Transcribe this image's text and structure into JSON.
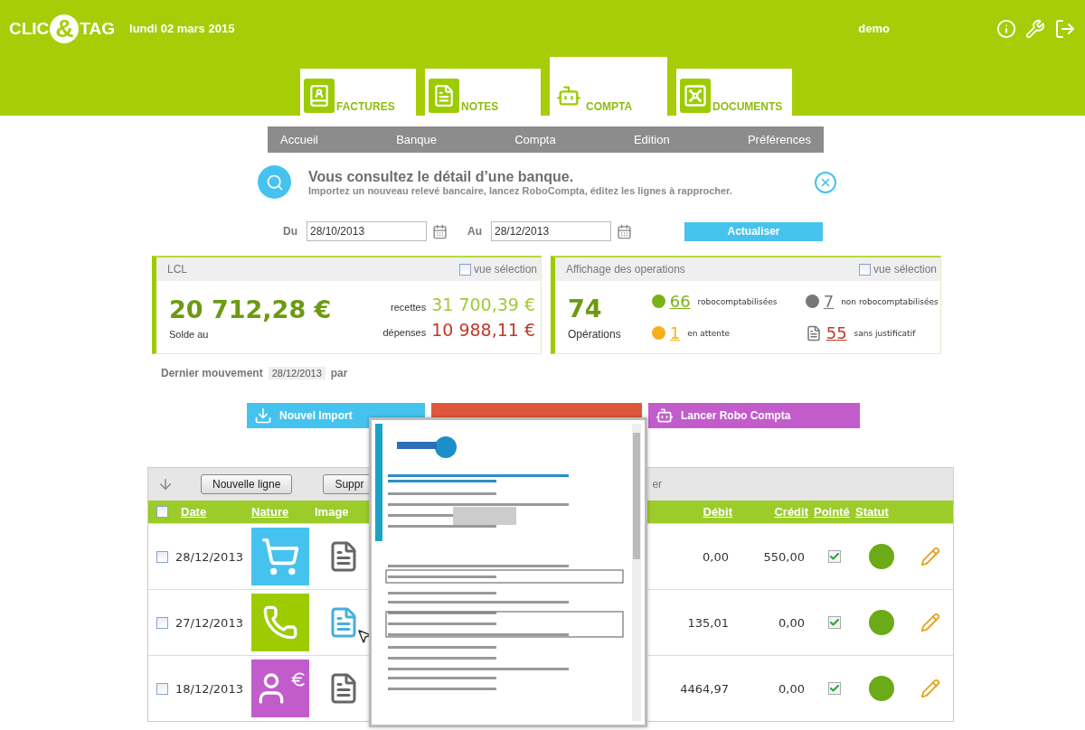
{
  "header": {
    "logo": {
      "left": "CLIC",
      "mark": "&",
      "right": "TAG"
    },
    "date": "lundi 02 mars 2015",
    "user": "demo"
  },
  "modules": [
    {
      "label": "FACTURES",
      "kind": "invoices",
      "selected": false
    },
    {
      "label": "NOTES",
      "kind": "notes",
      "selected": false
    },
    {
      "label": "COMPTA",
      "kind": "robot",
      "selected": true
    },
    {
      "label": "DOCUMENTS",
      "kind": "safe",
      "selected": false
    }
  ],
  "nav": [
    "Accueil",
    "Banque",
    "Compta",
    "Edition",
    "Préférences"
  ],
  "banner": {
    "title": "Vous consultez le détail d’une banque.",
    "subtitle": "Importez un nouveau relevé bancaire, lancez RoboCompta, éditez les lignes à rapprocher."
  },
  "filter": {
    "from_label": "Du",
    "from": "28/10/2013",
    "to_label": "Au",
    "to": "28/12/2013",
    "button": "Actualiser"
  },
  "bank_card": {
    "title": "LCL",
    "selection_label": "vue sélection",
    "selection_checked": false,
    "balance": "20 712,28 €",
    "balance_label": "Solde au",
    "income_label": "recettes",
    "income": "31 700,39 €",
    "expense_label": "dépenses",
    "expense": "10 988,11 €"
  },
  "ops_card": {
    "title": "Affichage des operations",
    "selection_label": "vue sélection",
    "selection_checked": false,
    "count": "74",
    "count_label": "Opérations",
    "stats": [
      {
        "kind": "dot",
        "color": "#7ab317",
        "value": "66",
        "label": "robocomptabilisées"
      },
      {
        "kind": "dot",
        "color": "#777777",
        "value": "7",
        "label": "non robocomptabilisées"
      },
      {
        "kind": "dot",
        "color": "#f5b01e",
        "value": "1",
        "label": "en attente"
      },
      {
        "kind": "document",
        "color": "#c0392b",
        "value": "55",
        "label": "sans justificatif"
      }
    ]
  },
  "last_movement": {
    "label": "Dernier mouvement",
    "date": "28/12/2013",
    "suffix": "par"
  },
  "actions": [
    {
      "label": "Nouvel Import",
      "kind": "import",
      "color": "#45c3ee"
    },
    {
      "kind": "hidden",
      "color": "#e0583c"
    },
    {
      "label": "Lancer Robo Compta",
      "kind": "robot",
      "color": "#c25ccb"
    }
  ],
  "table": {
    "toolbar": {
      "buttons": [
        "Nouvelle ligne",
        "Suppr"
      ],
      "trailing_text": "er"
    },
    "select_all_checked": false,
    "columns": [
      {
        "label": "Date",
        "sortable": true
      },
      {
        "label": "Nature",
        "sortable": true
      },
      {
        "label": "Image",
        "sortable": false
      },
      {
        "label": "Débit",
        "sortable": true
      },
      {
        "label": "Crédit",
        "sortable": true
      },
      {
        "label": "Pointé",
        "sortable": true
      },
      {
        "label": "Statut",
        "sortable": true
      }
    ],
    "rows": [
      {
        "checked": false,
        "date": "28/12/2013",
        "nature": {
          "kind": "cart",
          "color": "#45c3ee"
        },
        "image_highlighted": false,
        "debit": "0,00",
        "credit": "550,00",
        "pointed": true,
        "status_ok": true
      },
      {
        "checked": false,
        "date": "27/12/2013",
        "nature": {
          "kind": "phone",
          "color": "#9ccc00"
        },
        "image_highlighted": true,
        "debit": "135,01",
        "credit": "0,00",
        "pointed": true,
        "status_ok": true
      },
      {
        "checked": false,
        "date": "18/12/2013",
        "nature": {
          "kind": "salary",
          "color": "#c25ccb"
        },
        "image_highlighted": false,
        "debit": "4464,97",
        "credit": "0,00",
        "pointed": true,
        "status_ok": true
      }
    ]
  }
}
